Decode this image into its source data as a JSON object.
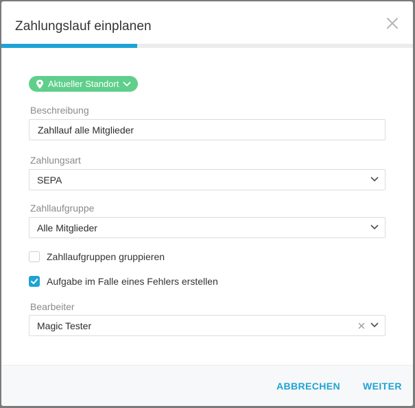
{
  "dialog": {
    "title": "Zahlungslauf einplanen",
    "progress_percent": 33
  },
  "location_badge": {
    "label": "Aktueller Standort"
  },
  "form": {
    "description": {
      "label": "Beschreibung",
      "value": "Zahllauf alle Mitglieder"
    },
    "payment_type": {
      "label": "Zahlungsart",
      "value": "SEPA"
    },
    "run_group": {
      "label": "Zahllaufgruppe",
      "value": "Alle Mitglieder"
    },
    "group_checkbox": {
      "label": "Zahllaufgruppen gruppieren",
      "checked": false
    },
    "task_checkbox": {
      "label": "Aufgabe im Falle eines Fehlers erstellen",
      "checked": true
    },
    "editor": {
      "label": "Bearbeiter",
      "value": "Magic Tester"
    }
  },
  "footer": {
    "cancel_label": "ABBRECHEN",
    "next_label": "WEITER"
  },
  "colors": {
    "accent": "#1ea3d5",
    "badge": "#5fcf8b"
  }
}
